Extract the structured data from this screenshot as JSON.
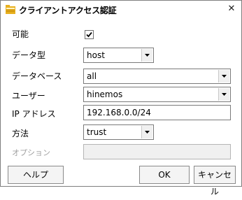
{
  "window": {
    "title": "クライアントアクセス認証",
    "close_glyph": "✕"
  },
  "form": {
    "enabled": {
      "label": "可能",
      "checked": true
    },
    "data_type": {
      "label": "データ型",
      "value": "host"
    },
    "database": {
      "label": "データベース",
      "value": "all"
    },
    "user": {
      "label": "ユーザー",
      "value": "hinemos"
    },
    "ip_address": {
      "label": "IP アドレス",
      "value": "192.168.0.0/24"
    },
    "method": {
      "label": "方法",
      "value": "trust"
    },
    "option": {
      "label": "オプション",
      "value": ""
    }
  },
  "buttons": {
    "help": "ヘルプ",
    "ok": "OK",
    "cancel": "キャンセル"
  },
  "colors": {
    "title_icon": "#e8b01e",
    "border": "#7a7a7a",
    "disabled_text": "#a0a0a0"
  }
}
